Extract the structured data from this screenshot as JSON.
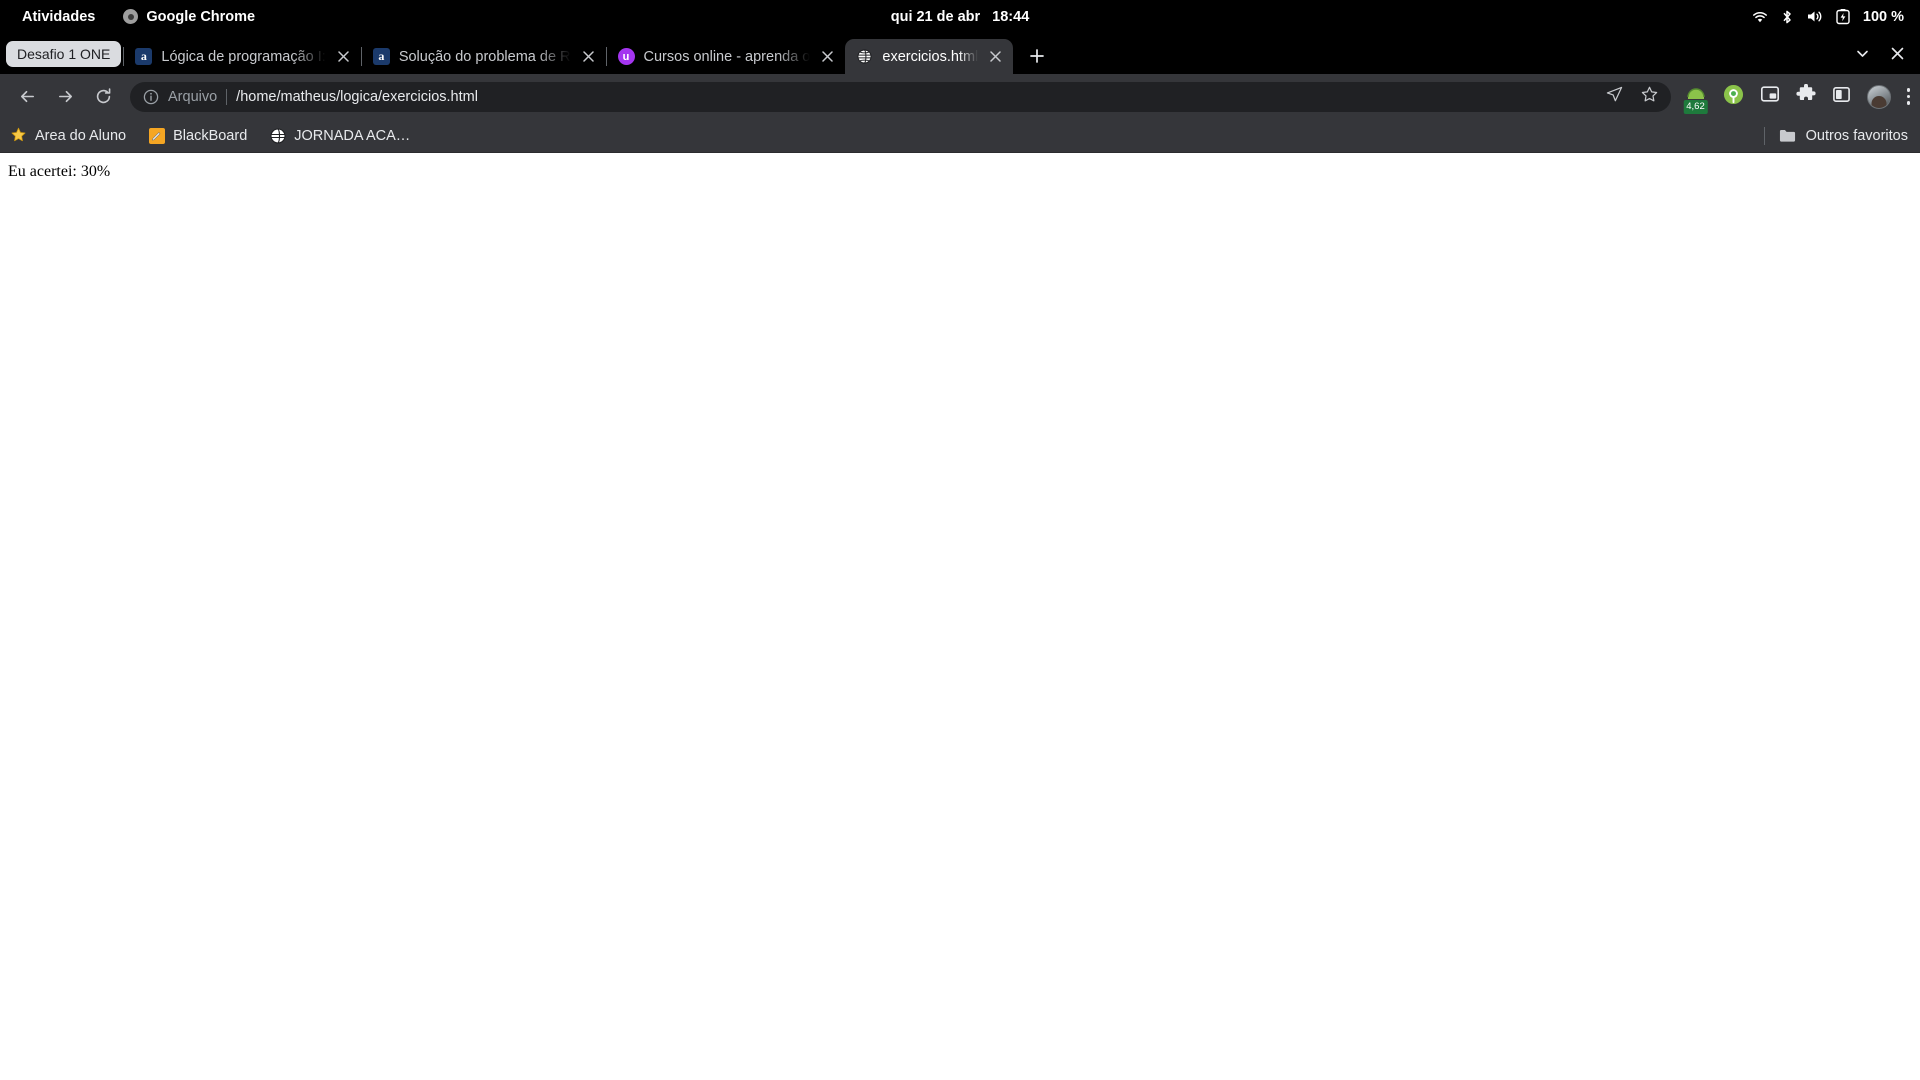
{
  "gnome": {
    "activities": "Atividades",
    "app_name": "Google Chrome",
    "app_icon": "chrome-icon",
    "clock": "qui 21 de abr",
    "time": "18:44",
    "tray": {
      "wifi_icon": "wifi-icon",
      "bluetooth_icon": "bluetooth-icon",
      "volume_icon": "volume-icon",
      "battery_icon": "battery-charging-icon",
      "battery_level": "100 %"
    }
  },
  "browser": {
    "tab_group": {
      "label": "Desafio 1 ONE",
      "color": "#dadce0"
    },
    "tabs": [
      {
        "title": "Lógica de programação I:",
        "favicon": "alura-icon",
        "favicon_letter": "a",
        "active": false
      },
      {
        "title": "Solução do problema de R",
        "favicon": "alura-icon",
        "favicon_letter": "a",
        "active": false
      },
      {
        "title": "Cursos online - aprenda o",
        "favicon": "udemy-icon",
        "favicon_letter": "u",
        "active": false
      },
      {
        "title": "exercicios.html",
        "favicon": "globe-icon",
        "favicon_letter": "",
        "active": true
      }
    ],
    "new_tab_label": "+",
    "window_controls": {
      "minimize": "chevron-down-icon",
      "close": "close-icon"
    },
    "nav": {
      "back": "back-arrow-icon",
      "forward": "forward-arrow-icon",
      "reload": "reload-icon"
    },
    "omnibox": {
      "info_icon": "info-circle-icon",
      "scheme_label": "Arquivo",
      "url": "/home/matheus/logica/exercicios.html",
      "share_icon": "share-icon",
      "bookmark_icon": "star-icon"
    },
    "toolbar_icons": [
      {
        "name": "extension-green-icon",
        "badge": "4,62",
        "badge_color": "#1e7a3c"
      },
      {
        "name": "extension-circle-green-icon",
        "badge": ""
      },
      {
        "name": "picture-in-picture-icon",
        "badge": ""
      },
      {
        "name": "extensions-puzzle-icon",
        "badge": ""
      },
      {
        "name": "side-panel-icon",
        "badge": ""
      }
    ],
    "avatar": "profile-avatar",
    "menu_icon": "three-dot-menu-icon",
    "bookmarks": [
      {
        "label": "Area do Aluno",
        "icon": "star-sparkle-icon"
      },
      {
        "label": "BlackBoard",
        "icon": "note-pencil-icon"
      },
      {
        "label": "JORNADA ACA…",
        "icon": "globe-icon"
      }
    ],
    "other_bookmarks": {
      "label": "Outros favoritos",
      "icon": "folder-icon"
    }
  },
  "page": {
    "content": "Eu acertei: 30%"
  }
}
